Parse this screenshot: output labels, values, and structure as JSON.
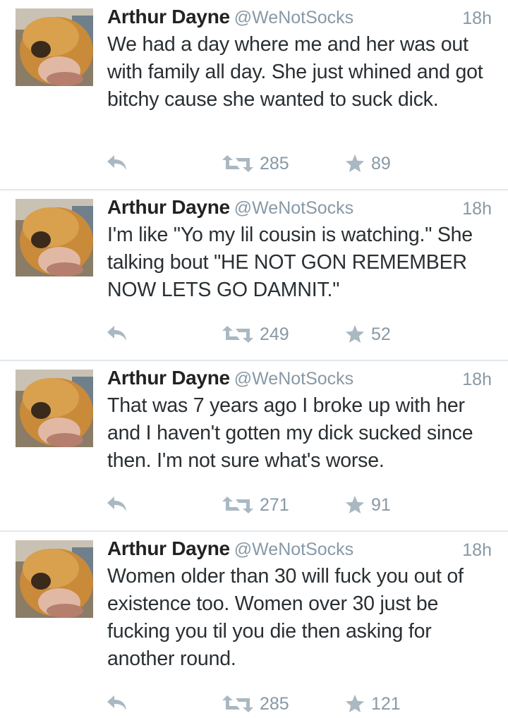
{
  "colors": {
    "name": "#222222",
    "secondary": "#8899a6",
    "icon": "#aab8c2",
    "divider": "#e1e8ed"
  },
  "tweets": [
    {
      "name": "Arthur Dayne",
      "handle": "@WeNotSocks",
      "time": "18h",
      "text": "We had a day where me and her was out with family all day. She just whined and got bitchy cause she wanted to suck dick.",
      "retweets": "285",
      "favorites": "89"
    },
    {
      "name": "Arthur Dayne",
      "handle": "@WeNotSocks",
      "time": "18h",
      "text": "I'm like \"Yo my lil cousin is watching.\" She talking bout \"HE NOT GON REMEMBER NOW LETS GO DAMNIT.\"",
      "retweets": "249",
      "favorites": "52"
    },
    {
      "name": "Arthur Dayne",
      "handle": "@WeNotSocks",
      "time": "18h",
      "text": "That was 7 years ago I broke up with her and I haven't gotten my dick sucked since then. I'm not sure what's worse.",
      "retweets": "271",
      "favorites": "91"
    },
    {
      "name": "Arthur Dayne",
      "handle": "@WeNotSocks",
      "time": "18h",
      "text": "Women older than 30 will fuck you out of existence too. Women over 30 just be fucking you til you die then asking for another round.",
      "retweets": "285",
      "favorites": "121"
    }
  ],
  "icons": {
    "reply": "reply-arrow-icon",
    "retweet": "retweet-icon",
    "favorite": "star-icon"
  }
}
